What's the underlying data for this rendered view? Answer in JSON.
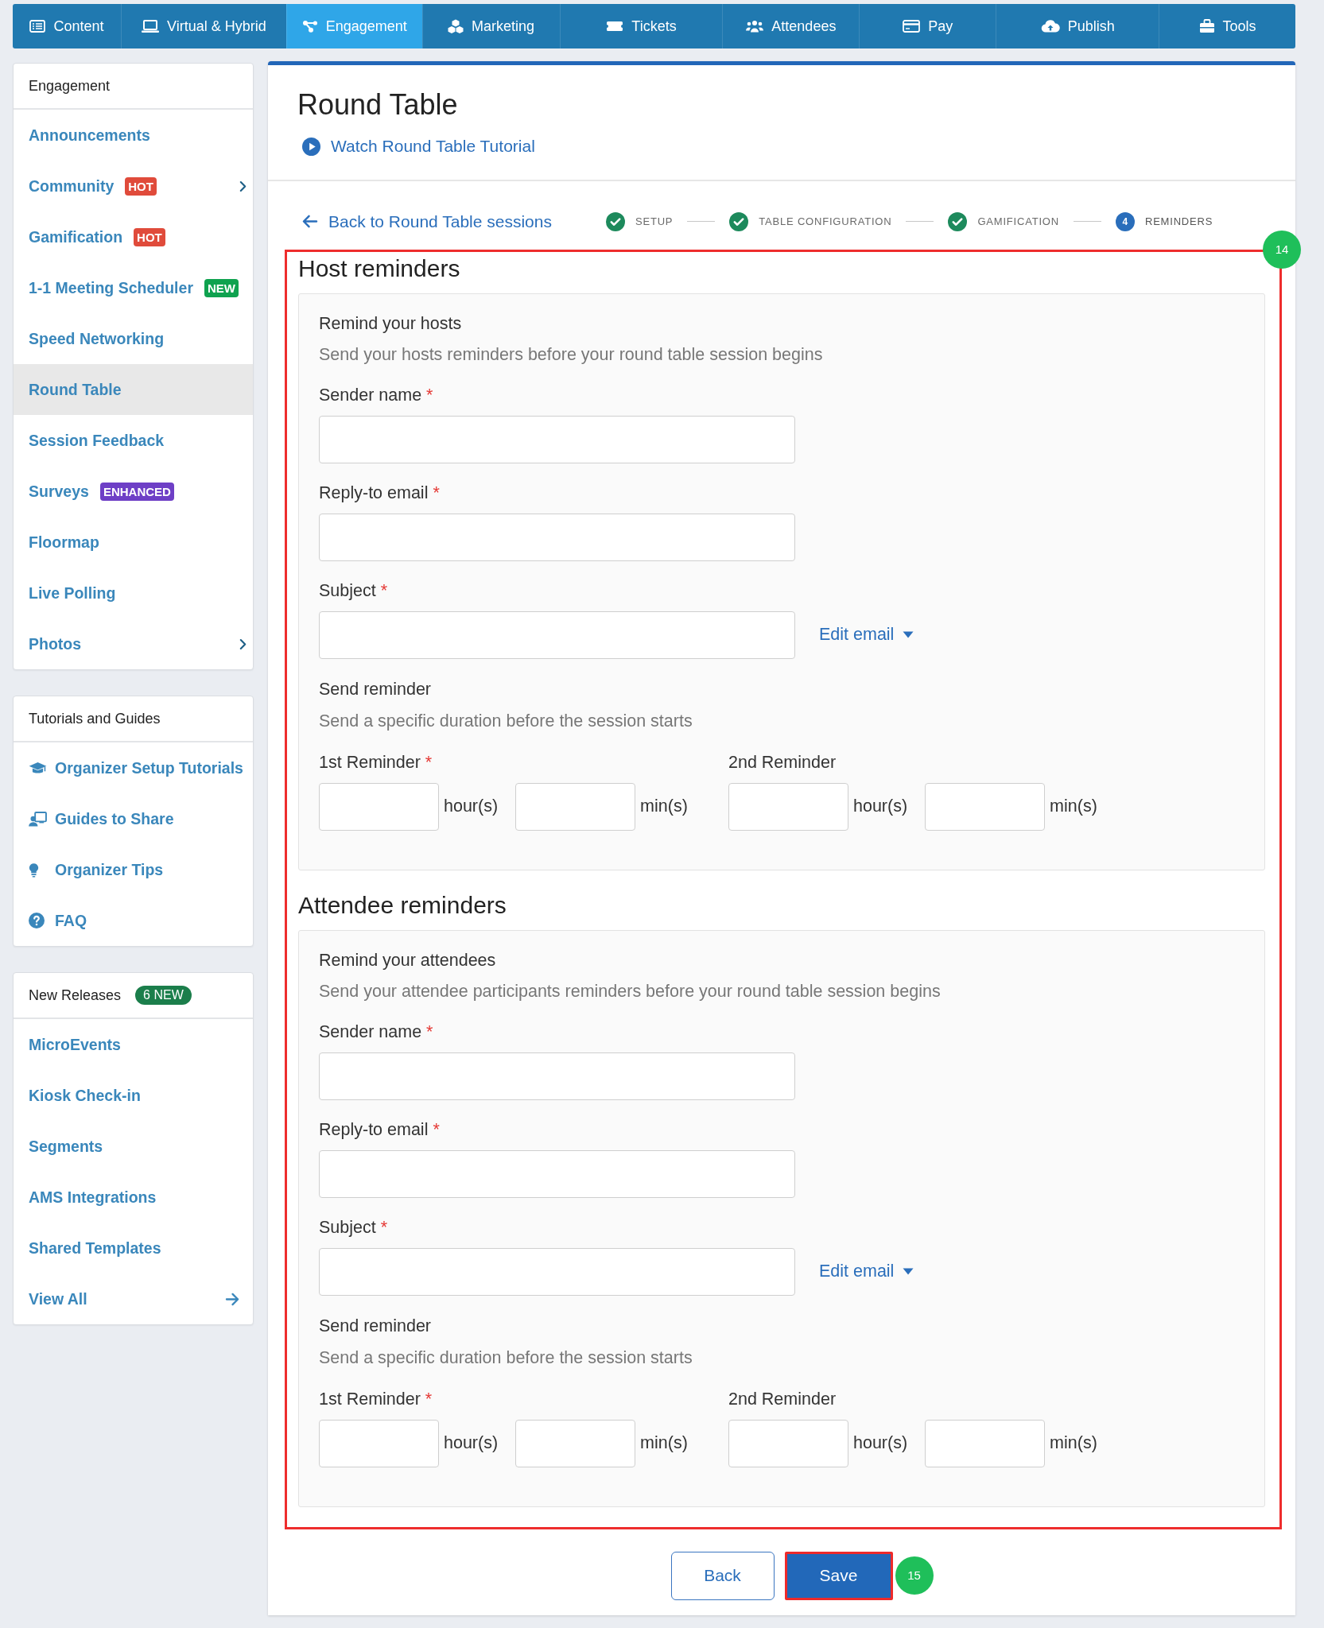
{
  "top_nav": {
    "tabs": [
      {
        "label": "Content",
        "selected": false
      },
      {
        "label": "Virtual & Hybrid",
        "selected": false
      },
      {
        "label": "Engagement",
        "selected": true
      },
      {
        "label": "Marketing",
        "selected": false
      },
      {
        "label": "Tickets",
        "selected": false
      },
      {
        "label": "Attendees",
        "selected": false
      },
      {
        "label": "Pay",
        "selected": false
      },
      {
        "label": "Publish",
        "selected": false
      },
      {
        "label": "Tools",
        "selected": false
      }
    ]
  },
  "sidebar": {
    "sections": [
      {
        "kind": "menu",
        "title": "Engagement",
        "items": [
          {
            "label": "Announcements",
            "selected": false,
            "expandable": false
          },
          {
            "label": "Community",
            "badge": {
              "text": "HOT",
              "color": "#e04b3b"
            },
            "selected": false,
            "expandable": true
          },
          {
            "label": "Gamification",
            "badge": {
              "text": "HOT",
              "color": "#e04b3b"
            },
            "selected": false,
            "expandable": false
          },
          {
            "label": "1-1 Meeting Scheduler",
            "badge": {
              "text": "NEW",
              "color": "#0fa24f"
            },
            "selected": false,
            "expandable": false
          },
          {
            "label": "Speed Networking",
            "selected": false,
            "expandable": false
          },
          {
            "label": "Round Table",
            "selected": true,
            "expandable": false
          },
          {
            "label": "Session Feedback",
            "selected": false,
            "expandable": false
          },
          {
            "label": "Surveys",
            "badge": {
              "text": "ENHANCED",
              "color": "#6e3fc6"
            },
            "selected": false,
            "expandable": false
          },
          {
            "label": "Floormap",
            "selected": false,
            "expandable": false
          },
          {
            "label": "Live Polling",
            "selected": false,
            "expandable": false
          },
          {
            "label": "Photos",
            "selected": false,
            "expandable": true
          }
        ]
      },
      {
        "kind": "guides",
        "title": "Tutorials and Guides",
        "items": [
          {
            "label": "Organizer Setup Tutorials"
          },
          {
            "label": "Guides to Share"
          },
          {
            "label": "Organizer Tips"
          },
          {
            "label": "FAQ"
          }
        ]
      },
      {
        "kind": "menu",
        "title": "New Releases",
        "count_badge": "6 NEW",
        "items": [
          {
            "label": "MicroEvents",
            "arrow": false
          },
          {
            "label": "Kiosk Check-in",
            "arrow": false
          },
          {
            "label": "Segments",
            "arrow": false
          },
          {
            "label": "AMS Integrations",
            "arrow": false
          },
          {
            "label": "Shared Templates",
            "arrow": false
          },
          {
            "label": "View All",
            "arrow": true
          }
        ]
      }
    ]
  },
  "main": {
    "title": "Round Table",
    "tutorial_link": "Watch Round Table Tutorial",
    "back_link": "Back to Round Table sessions",
    "steps": [
      {
        "label": "SETUP",
        "completed": true,
        "selected": false
      },
      {
        "label": "TABLE CONFIGURATION",
        "completed": true,
        "selected": false
      },
      {
        "label": "GAMIFICATION",
        "completed": true,
        "selected": false
      },
      {
        "label": "REMINDERS",
        "number": "4",
        "completed": false,
        "selected": true
      }
    ]
  },
  "form": {
    "callout": "14",
    "sections": [
      {
        "heading": "Host reminders",
        "card_title": "Remind your hosts",
        "description": "Send your hosts reminders before your round table session begins",
        "fields": [
          {
            "label": "Sender name",
            "required_mark": "*"
          },
          {
            "label": "Reply-to email",
            "required_mark": "*"
          },
          {
            "label": "Subject",
            "required_mark": "*",
            "action": "Edit email"
          }
        ],
        "reminder": {
          "title": "Send reminder",
          "description": "Send a specific duration before the session starts",
          "slots": [
            {
              "label": "1st Reminder",
              "required_mark": "*",
              "units": [
                "hour(s)",
                "min(s)"
              ]
            },
            {
              "label": "2nd Reminder",
              "units": [
                "hour(s)",
                "min(s)"
              ]
            }
          ]
        }
      },
      {
        "heading": "Attendee reminders",
        "card_title": "Remind your attendees",
        "description": "Send your attendee participants reminders before your round table session begins",
        "fields": [
          {
            "label": "Sender name",
            "required_mark": "*"
          },
          {
            "label": "Reply-to email",
            "required_mark": "*"
          },
          {
            "label": "Subject",
            "required_mark": "*",
            "action": "Edit email"
          }
        ],
        "reminder": {
          "title": "Send reminder",
          "description": "Send a specific duration before the session starts",
          "slots": [
            {
              "label": "1st Reminder",
              "required_mark": "*",
              "units": [
                "hour(s)",
                "min(s)"
              ]
            },
            {
              "label": "2nd Reminder",
              "units": [
                "hour(s)",
                "min(s)"
              ]
            }
          ]
        }
      }
    ]
  },
  "buttons": [
    {
      "label": "Back",
      "kind": "secondary"
    },
    {
      "label": "Save",
      "kind": "primary",
      "callout": "15"
    }
  ]
}
